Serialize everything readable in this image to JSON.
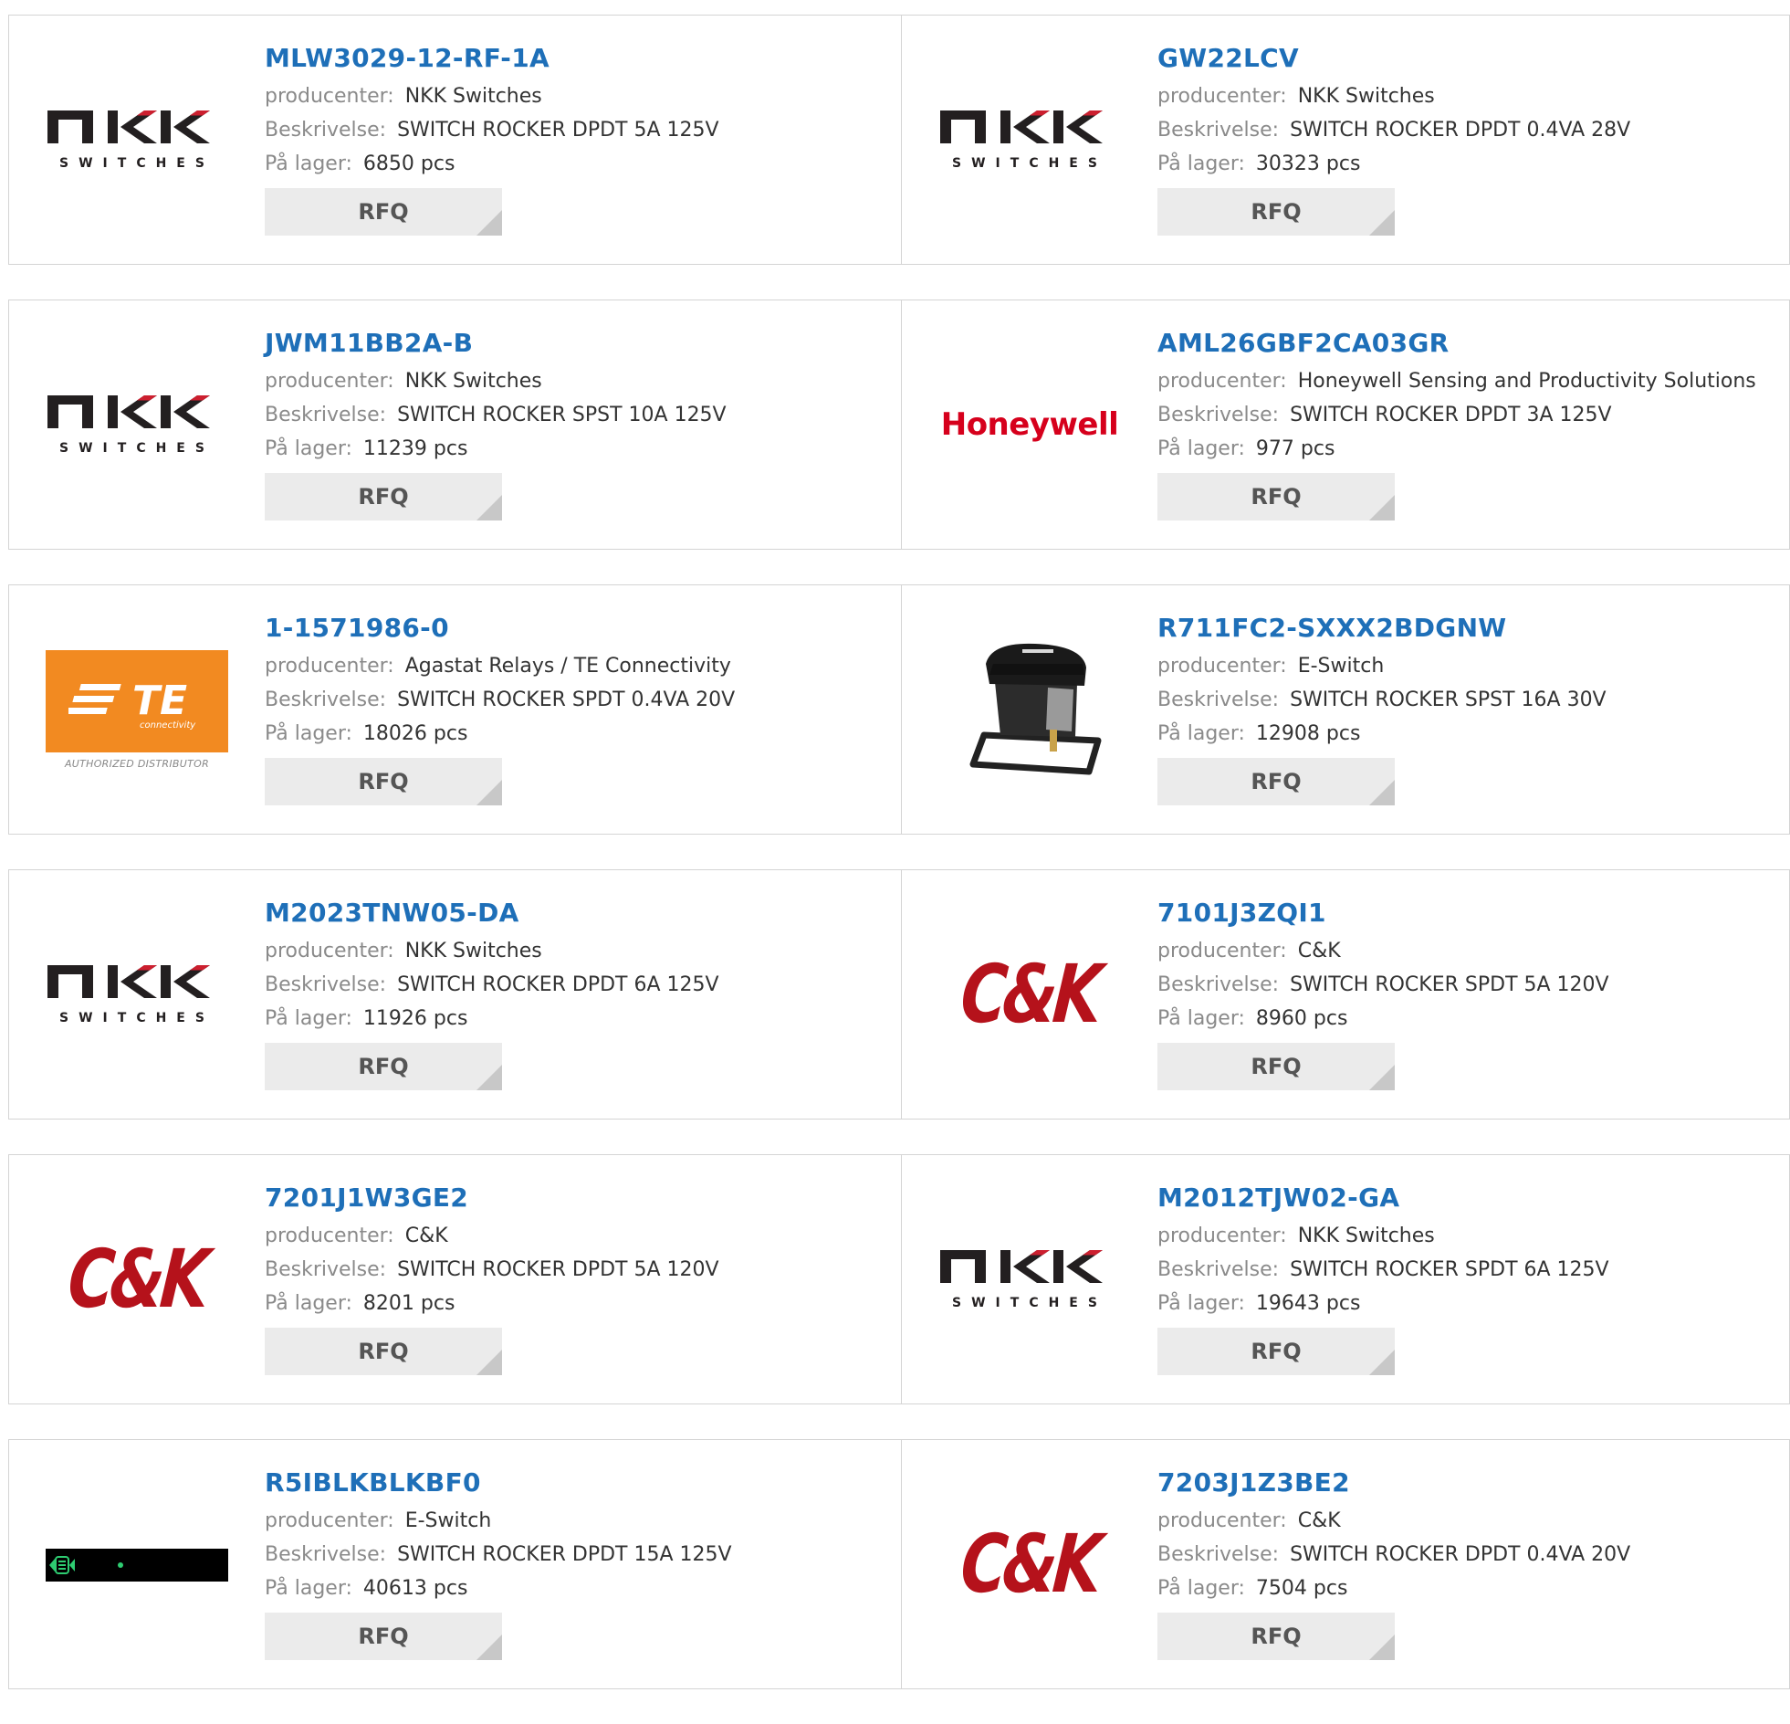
{
  "labels": {
    "producer": "producenter:",
    "description": "Beskrivelse:",
    "stock": "På lager:",
    "rfq": "RFQ"
  },
  "logo_text": {
    "nkk_top": "nKK",
    "nkk_bottom": "SWITCHES",
    "honeywell": "Honeywell",
    "te": "TE",
    "te_sub": "connectivity",
    "te_dist": "AUTHORIZED DISTRIBUTOR",
    "ck": "C&K"
  },
  "colors": {
    "link": "#1e6fb8",
    "honeywell": "#d6001c",
    "te_orange": "#f28a21",
    "ck_red": "#b5121b"
  },
  "products": [
    {
      "part": "MLW3029-12-RF-1A",
      "producer": "NKK Switches",
      "description": "SWITCH ROCKER DPDT 5A 125V",
      "stock": "6850 pcs",
      "logo": "nkk-logo"
    },
    {
      "part": "GW22LCV",
      "producer": "NKK Switches",
      "description": "SWITCH ROCKER DPDT 0.4VA 28V",
      "stock": "30323 pcs",
      "logo": "nkk-logo"
    },
    {
      "part": "JWM11BB2A-B",
      "producer": "NKK Switches",
      "description": "SWITCH ROCKER SPST 10A 125V",
      "stock": "11239 pcs",
      "logo": "nkk-logo"
    },
    {
      "part": "AML26GBF2CA03GR",
      "producer": "Honeywell Sensing and Productivity Solutions",
      "description": "SWITCH ROCKER DPDT 3A 125V",
      "stock": "977 pcs",
      "logo": "honeywell-logo"
    },
    {
      "part": "1-1571986-0",
      "producer": "Agastat Relays / TE Connectivity",
      "description": "SWITCH ROCKER SPDT 0.4VA 20V",
      "stock": "18026 pcs",
      "logo": "te-logo"
    },
    {
      "part": "R711FC2-SXXX2BDGNW",
      "producer": "E-Switch",
      "description": "SWITCH ROCKER SPST 16A 30V",
      "stock": "12908 pcs",
      "logo": "rocker-switch-photo"
    },
    {
      "part": "M2023TNW05-DA",
      "producer": "NKK Switches",
      "description": "SWITCH ROCKER DPDT 6A 125V",
      "stock": "11926 pcs",
      "logo": "nkk-logo"
    },
    {
      "part": "7101J3ZQI1",
      "producer": "C&K",
      "description": "SWITCH ROCKER SPDT 5A 120V",
      "stock": "8960 pcs",
      "logo": "ck-logo"
    },
    {
      "part": "7201J1W3GE2",
      "producer": "C&K",
      "description": "SWITCH ROCKER DPDT 5A 120V",
      "stock": "8201 pcs",
      "logo": "ck-logo"
    },
    {
      "part": "M2012TJW02-GA",
      "producer": "NKK Switches",
      "description": "SWITCH ROCKER SPDT 6A 125V",
      "stock": "19643 pcs",
      "logo": "nkk-logo"
    },
    {
      "part": "R5IBLKBLKBF0",
      "producer": "E-Switch",
      "description": "SWITCH ROCKER DPDT 15A 125V",
      "stock": "40613 pcs",
      "logo": "rocker-switch-photo-black"
    },
    {
      "part": "7203J1Z3BE2",
      "producer": "C&K",
      "description": "SWITCH ROCKER DPDT 0.4VA 20V",
      "stock": "7504 pcs",
      "logo": "ck-logo"
    }
  ]
}
